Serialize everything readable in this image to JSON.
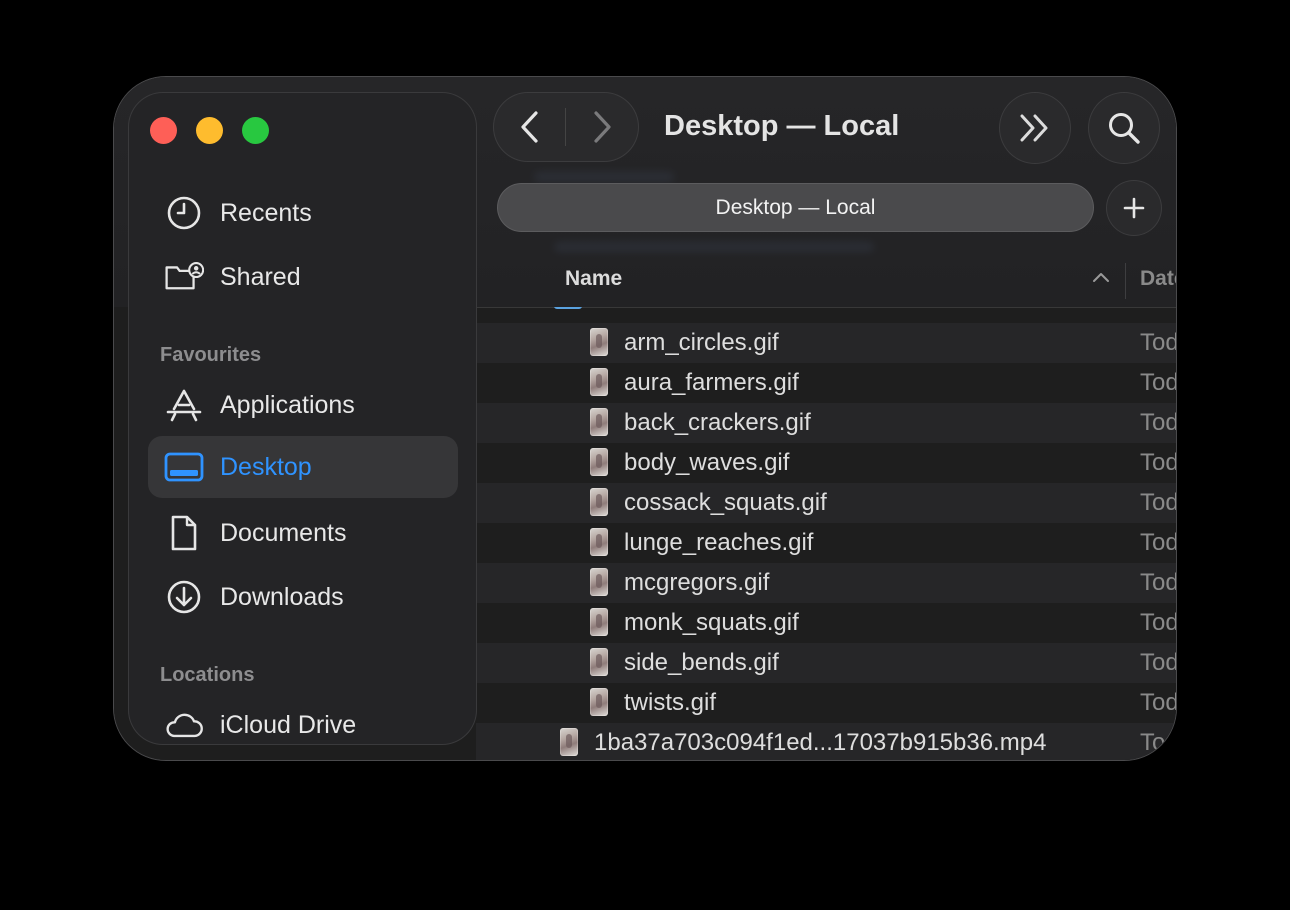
{
  "window": {
    "title": "Desktop — Local",
    "tab_label": "Desktop — Local"
  },
  "sidebar": {
    "items_top": [
      {
        "label": "Recents",
        "icon": "clock-icon"
      },
      {
        "label": "Shared",
        "icon": "shared-folder-icon"
      }
    ],
    "favourites_title": "Favourites",
    "favourites": [
      {
        "label": "Applications",
        "icon": "applications-icon"
      },
      {
        "label": "Desktop",
        "icon": "desktop-icon",
        "selected": true
      },
      {
        "label": "Documents",
        "icon": "document-icon"
      },
      {
        "label": "Downloads",
        "icon": "download-icon"
      }
    ],
    "locations_title": "Locations",
    "locations": [
      {
        "label": "iCloud Drive",
        "icon": "cloud-icon"
      }
    ]
  },
  "columns": {
    "name": "Name",
    "date": "Date"
  },
  "files": {
    "partial_folder": "1ba37a703c094f1ed7317037b915b36",
    "gifs": [
      {
        "name": "arm_circles.gif",
        "date": "Tod"
      },
      {
        "name": "aura_farmers.gif",
        "date": "Tod"
      },
      {
        "name": "back_crackers.gif",
        "date": "Tod"
      },
      {
        "name": "body_waves.gif",
        "date": "Tod"
      },
      {
        "name": "cossack_squats.gif",
        "date": "Tod"
      },
      {
        "name": "lunge_reaches.gif",
        "date": "Tod"
      },
      {
        "name": "mcgregors.gif",
        "date": "Tod"
      },
      {
        "name": "monk_squats.gif",
        "date": "Tod"
      },
      {
        "name": "side_bends.gif",
        "date": "Tod"
      },
      {
        "name": "twists.gif",
        "date": "Tod"
      }
    ],
    "video": {
      "name": "1ba37a703c094f1ed...17037b915b36.mp4",
      "date": "To"
    }
  },
  "colors": {
    "accent": "#2f93ff",
    "close": "#fe5f57",
    "minimize": "#febc2e",
    "maximize": "#28c840"
  }
}
